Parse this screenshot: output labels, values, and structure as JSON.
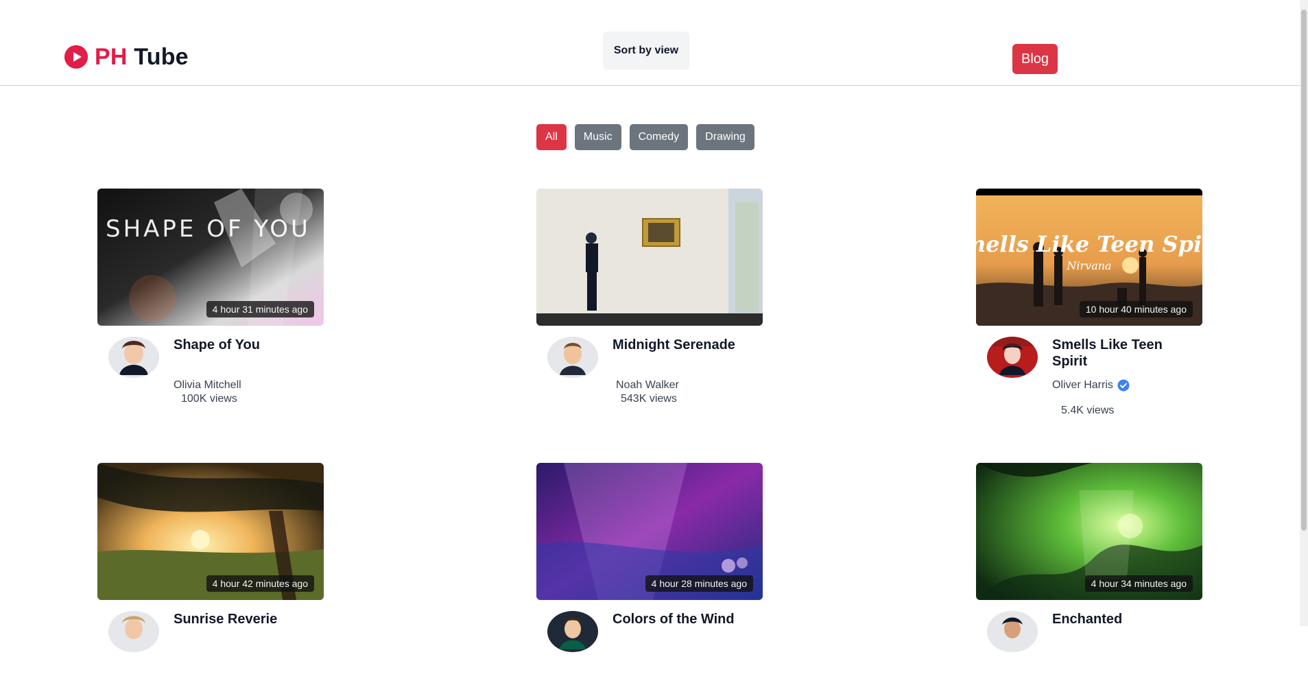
{
  "header": {
    "logo_ph": "PH",
    "logo_tube": "Tube",
    "sort_label": "Sort by view",
    "blog_label": "Blog"
  },
  "categories": [
    {
      "label": "All",
      "active": true
    },
    {
      "label": "Music",
      "active": false
    },
    {
      "label": "Comedy",
      "active": false
    },
    {
      "label": "Drawing",
      "active": false
    }
  ],
  "videos": [
    {
      "title": "Shape of You",
      "author": "Olivia Mitchell",
      "verified": false,
      "views": "100K views",
      "posted": "4 hour 31 minutes ago",
      "thumbnail_text": "SHAPE OF YOU"
    },
    {
      "title": "Midnight Serenade",
      "author": "Noah Walker",
      "verified": false,
      "views": "543K views",
      "posted": ""
    },
    {
      "title": "Smells Like Teen Spirit",
      "author": "Oliver Harris",
      "verified": true,
      "views": "5.4K views",
      "posted": "10 hour 40 minutes ago",
      "thumbnail_text": "Smells Like Teen Spirit",
      "thumbnail_subtext": "Nirvana"
    },
    {
      "title": "Sunrise Reverie",
      "author": "",
      "verified": false,
      "views": "",
      "posted": "4 hour 42 minutes ago"
    },
    {
      "title": "Colors of the Wind",
      "author": "",
      "verified": false,
      "views": "",
      "posted": "4 hour 28 minutes ago"
    },
    {
      "title": "Enchanted",
      "author": "",
      "verified": false,
      "views": "",
      "posted": "4 hour 34 minutes ago"
    }
  ],
  "colors": {
    "brand": "#e11d48",
    "active_category": "#dc3545",
    "inactive_category": "#6c757d",
    "verified": "#3b82f6"
  }
}
